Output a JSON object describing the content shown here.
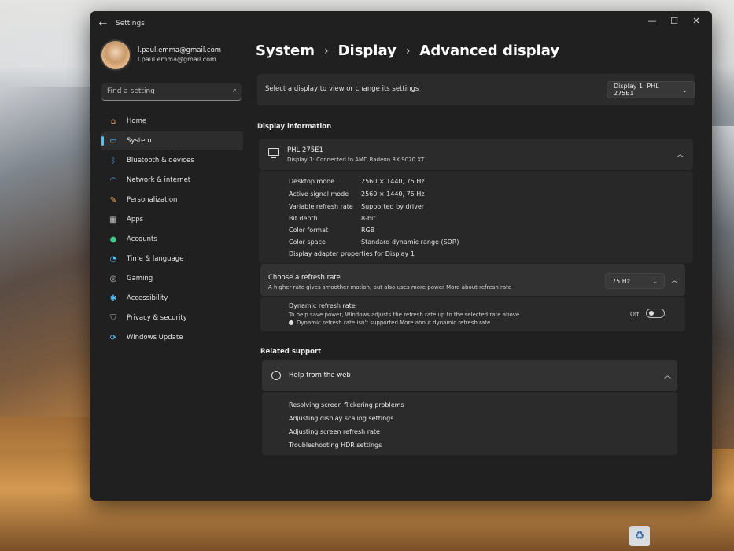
{
  "window": {
    "title": "Settings",
    "back_icon": "arrow-left-icon",
    "controls": [
      "—",
      "☐",
      "✕"
    ]
  },
  "user": {
    "name": "l.paul.emma@gmail.com",
    "email": "l.paul.emma@gmail.com"
  },
  "search": {
    "placeholder": "Find a setting"
  },
  "sidebar": {
    "items": [
      {
        "label": "Home",
        "icon": "home-icon"
      },
      {
        "label": "System",
        "icon": "system-icon",
        "active": true
      },
      {
        "label": "Bluetooth & devices",
        "icon": "bluetooth-icon"
      },
      {
        "label": "Network & internet",
        "icon": "wifi-icon"
      },
      {
        "label": "Personalization",
        "icon": "brush-icon"
      },
      {
        "label": "Apps",
        "icon": "apps-icon"
      },
      {
        "label": "Accounts",
        "icon": "accounts-icon"
      },
      {
        "label": "Time & language",
        "icon": "globe-clock-icon"
      },
      {
        "label": "Gaming",
        "icon": "gamepad-icon"
      },
      {
        "label": "Accessibility",
        "icon": "accessibility-icon"
      },
      {
        "label": "Privacy & security",
        "icon": "shield-icon"
      },
      {
        "label": "Windows Update",
        "icon": "update-icon"
      }
    ]
  },
  "breadcrumb": [
    "System",
    "Display",
    "Advanced display"
  ],
  "display_select": {
    "label": "Select a display to view or change its settings",
    "value": "Display 1: PHL 275E1"
  },
  "display_info": {
    "section_label": "Display information",
    "name": "PHL 275E1",
    "subtitle": "Display 1: Connected to AMD Radeon RX 9070 XT",
    "rows": [
      {
        "label": "Desktop mode",
        "value": "2560 × 1440, 75 Hz"
      },
      {
        "label": "Active signal mode",
        "value": "2560 × 1440, 75 Hz"
      },
      {
        "label": "Variable refresh rate",
        "value": "Supported by driver"
      },
      {
        "label": "Bit depth",
        "value": "8-bit"
      },
      {
        "label": "Color format",
        "value": "RGB"
      },
      {
        "label": "Color space",
        "value": "Standard dynamic range (SDR)"
      }
    ],
    "adapter_link": "Display adapter properties for Display 1"
  },
  "refresh": {
    "title": "Choose a refresh rate",
    "subtitle": "A higher rate gives smoother motion, but also uses more power  More about refresh rate",
    "value": "75 Hz",
    "dynamic_title": "Dynamic refresh rate",
    "dynamic_subtitle": "To help save power, Windows adjusts the refresh rate up to the selected rate above",
    "dynamic_note": "Dynamic refresh rate isn't supported  More about dynamic refresh rate",
    "toggle_label": "Off"
  },
  "related": {
    "section_label": "Related support",
    "help_title": "Help from the web",
    "links": [
      "Resolving screen flickering problems",
      "Adjusting display scaling settings",
      "Adjusting screen refresh rate",
      "Troubleshooting HDR settings"
    ]
  },
  "colors": {
    "accent": "#4cc2ff",
    "window_bg": "#202020",
    "card_bg": "#2b2b2b"
  }
}
